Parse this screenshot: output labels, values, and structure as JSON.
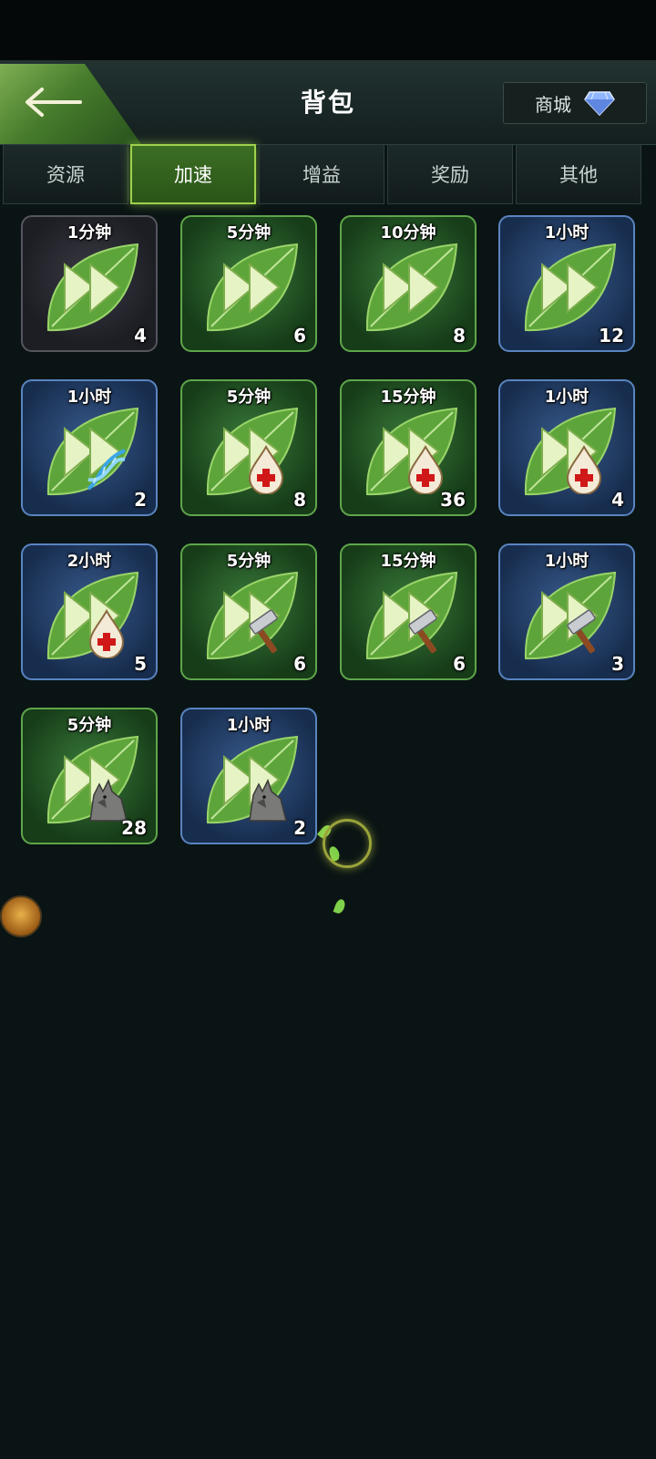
{
  "header": {
    "title": "背包",
    "shop_label": "商城",
    "back_icon": "back-arrow-icon",
    "shop_icon": "diamond-icon"
  },
  "tabs": [
    {
      "label": "资源",
      "active": false
    },
    {
      "label": "加速",
      "active": true
    },
    {
      "label": "增益",
      "active": false
    },
    {
      "label": "奖励",
      "active": false
    },
    {
      "label": "其他",
      "active": false
    }
  ],
  "items": [
    {
      "label": "1分钟",
      "count": "4",
      "frame": "dark",
      "badge": "none"
    },
    {
      "label": "5分钟",
      "count": "6",
      "frame": "green",
      "badge": "none"
    },
    {
      "label": "10分钟",
      "count": "8",
      "frame": "green",
      "badge": "none"
    },
    {
      "label": "1小时",
      "count": "12",
      "frame": "blue",
      "badge": "none"
    },
    {
      "label": "1小时",
      "count": "2",
      "frame": "blue",
      "badge": "dna"
    },
    {
      "label": "5分钟",
      "count": "8",
      "frame": "green",
      "badge": "heal"
    },
    {
      "label": "15分钟",
      "count": "36",
      "frame": "green",
      "badge": "heal"
    },
    {
      "label": "1小时",
      "count": "4",
      "frame": "blue",
      "badge": "heal"
    },
    {
      "label": "2小时",
      "count": "5",
      "frame": "blue",
      "badge": "heal"
    },
    {
      "label": "5分钟",
      "count": "6",
      "frame": "green",
      "badge": "hammer"
    },
    {
      "label": "15分钟",
      "count": "6",
      "frame": "green",
      "badge": "hammer"
    },
    {
      "label": "1小时",
      "count": "3",
      "frame": "blue",
      "badge": "hammer"
    },
    {
      "label": "5分钟",
      "count": "28",
      "frame": "green",
      "badge": "wolf"
    },
    {
      "label": "1小时",
      "count": "2",
      "frame": "blue",
      "badge": "wolf"
    }
  ],
  "colors": {
    "accent": "#9fd14b",
    "background": "#0a1414"
  }
}
